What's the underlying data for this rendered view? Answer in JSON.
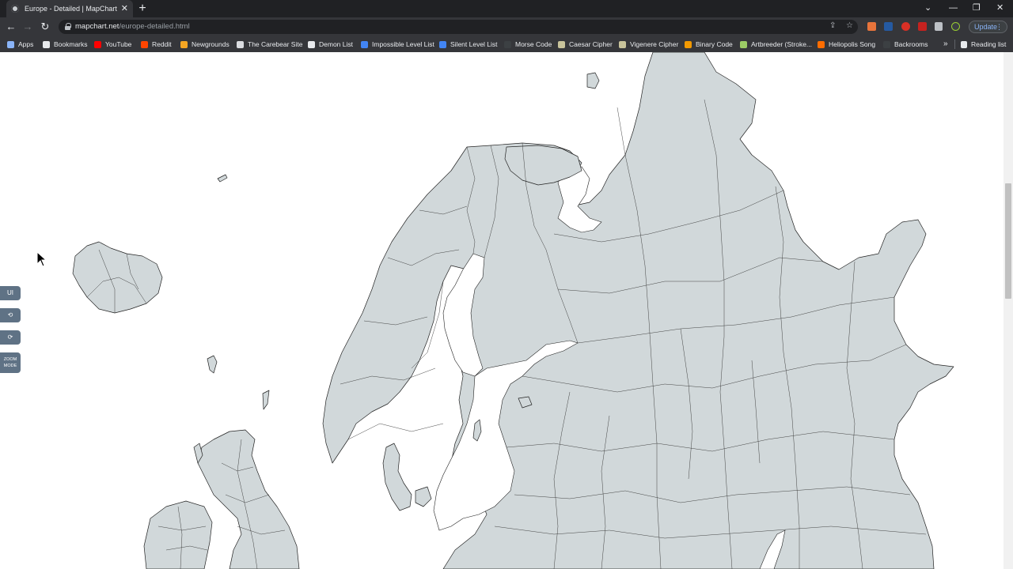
{
  "browser": {
    "tab": {
      "title": "Europe - Detailed | MapChart",
      "favicon": "mapchart-globe-icon"
    },
    "url": {
      "host": "mapchart.net",
      "path": "/europe-detailed.html"
    },
    "update_label": "Update",
    "bookmarks": [
      {
        "label": "Apps",
        "icon": "apps-grid-icon",
        "color": "#8ab4f8"
      },
      {
        "label": "Bookmarks",
        "icon": "star-icon",
        "color": "#e8eaed"
      },
      {
        "label": "YouTube",
        "icon": "youtube-icon",
        "color": "#ff0000"
      },
      {
        "label": "Reddit",
        "icon": "reddit-icon",
        "color": "#ff4500"
      },
      {
        "label": "Newgrounds",
        "icon": "newgrounds-icon",
        "color": "#f5a623"
      },
      {
        "label": "The Carebear Site",
        "icon": "page-icon",
        "color": "#dadce0"
      },
      {
        "label": "Demon List",
        "icon": "globe-icon",
        "color": "#e8eaed"
      },
      {
        "label": "Impossible Level List",
        "icon": "docs-icon",
        "color": "#4285f4"
      },
      {
        "label": "Silent Level List",
        "icon": "docs-icon",
        "color": "#4285f4"
      },
      {
        "label": "Morse Code",
        "icon": "page-icon",
        "color": "#3c4043"
      },
      {
        "label": "Caesar Cipher",
        "icon": "page-icon",
        "color": "#c8c39b"
      },
      {
        "label": "Vigenere Cipher",
        "icon": "page-icon",
        "color": "#c8c39b"
      },
      {
        "label": "Binary Code",
        "icon": "page-icon",
        "color": "#f29900"
      },
      {
        "label": "Artbreeder (Stroke...",
        "icon": "artbreeder-icon",
        "color": "#9ccc65"
      },
      {
        "label": "Heliopolis Song",
        "icon": "page-icon",
        "color": "#ff6d00"
      },
      {
        "label": "Backrooms",
        "icon": "page-icon",
        "color": "#3c4043"
      }
    ],
    "reading_list": "Reading list"
  },
  "page": {
    "side_buttons": {
      "ui": "UI",
      "undo": "⟲",
      "redo": "⟳",
      "zoom_mode": "ZOOM MODE"
    },
    "map_fill": "#d1d8da"
  }
}
